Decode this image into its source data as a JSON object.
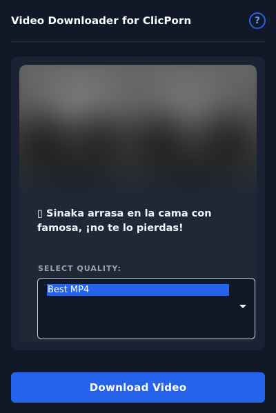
{
  "header": {
    "title": "Video Downloader for ClicPorn",
    "help_icon": "question-mark-icon",
    "help_label": "?"
  },
  "video": {
    "thumbnail_icon": "blurred-thumbnail-image",
    "title": "▯ Sinaka arrasa en la cama con famosa, ¡no te lo pierdas!"
  },
  "quality": {
    "label": "SELECT QUALITY:",
    "selected": "Best MP4",
    "dropdown_icon": "chevron-down-icon"
  },
  "actions": {
    "download_label": "Download Video"
  },
  "colors": {
    "background": "#111827",
    "panel": "#1a2233",
    "card": "#1f2837",
    "accent": "#2563eb",
    "muted_text": "#9ca3af"
  }
}
